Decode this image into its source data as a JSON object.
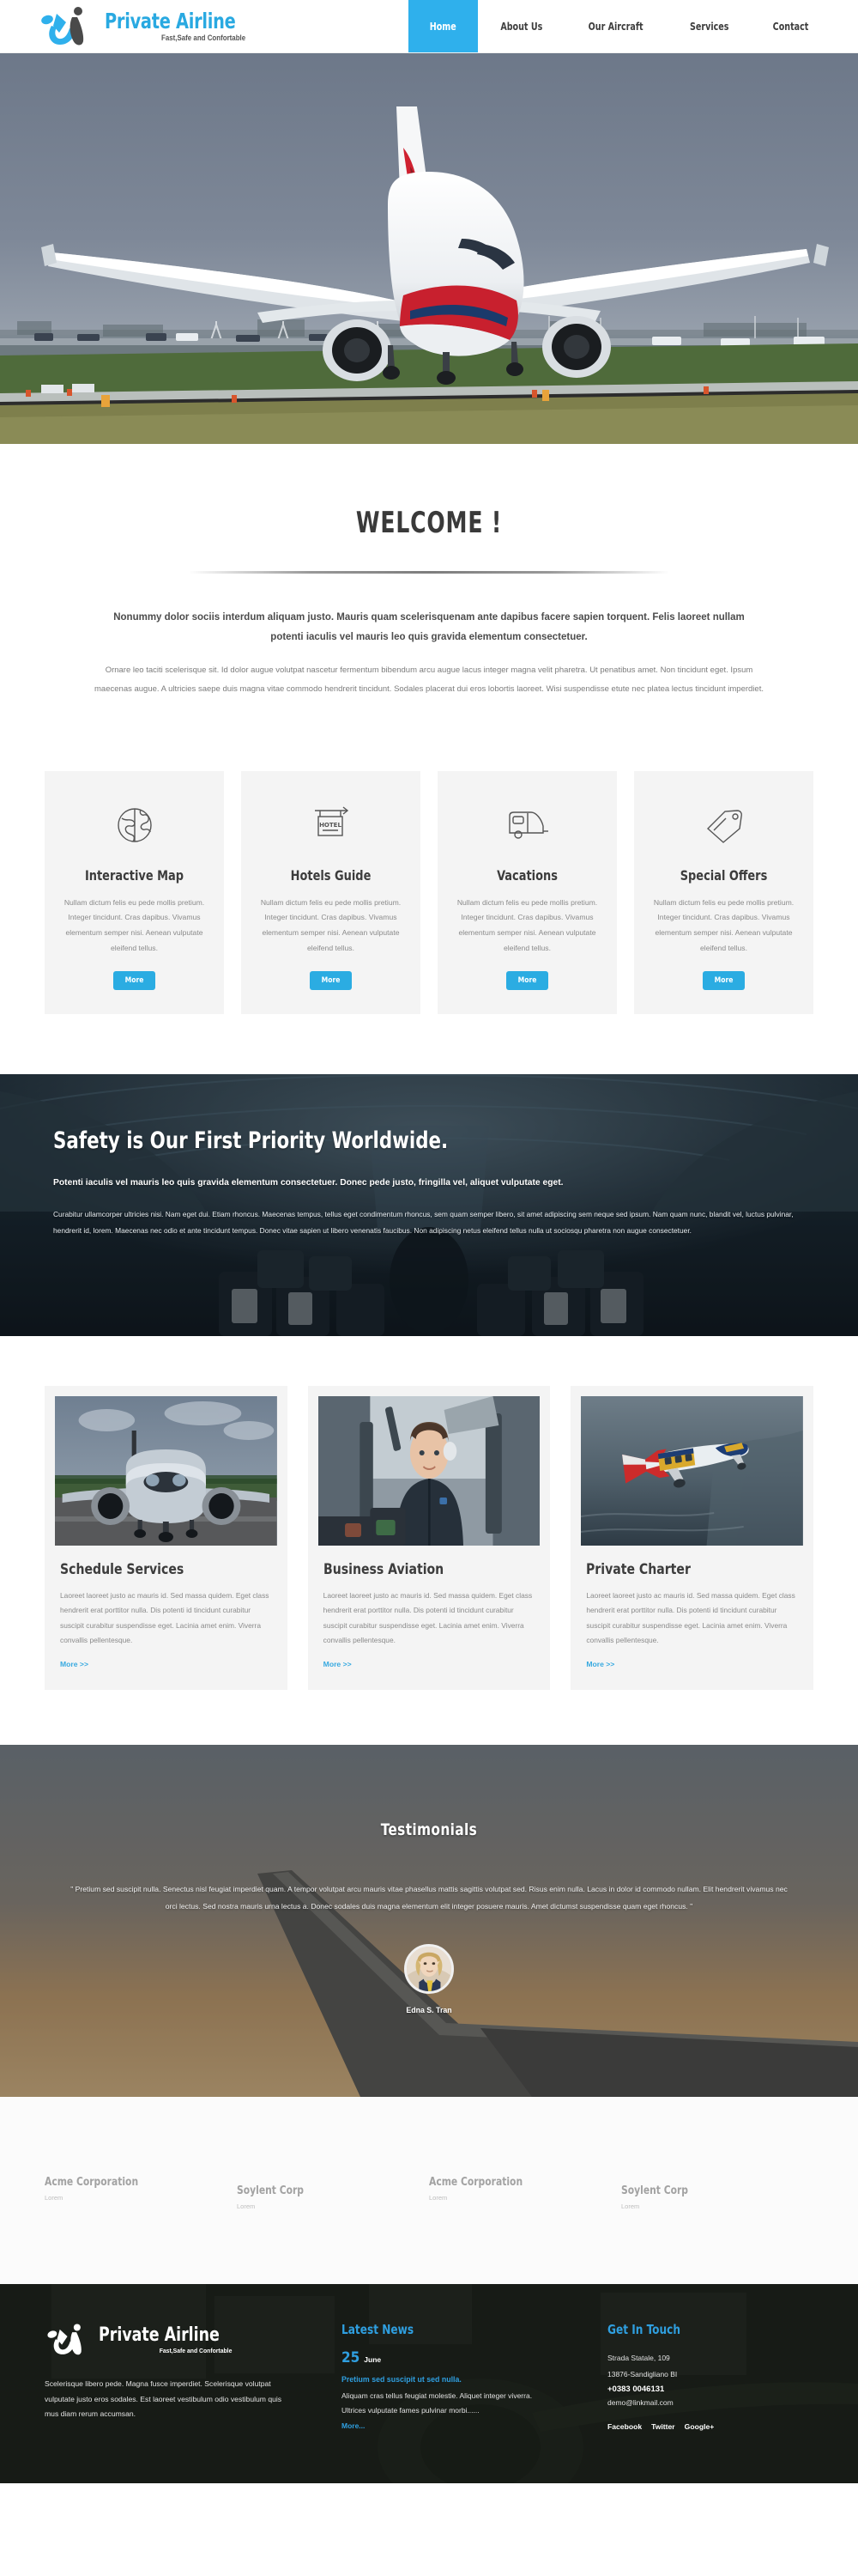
{
  "header": {
    "logo": {
      "name": "Private Airline",
      "tagline": "Fast,Safe and Confortable",
      "icon": "airline-swoosh-logo"
    },
    "nav": [
      {
        "label": "Home",
        "active": true
      },
      {
        "label": "About Us",
        "active": false
      },
      {
        "label": "Our Aircraft",
        "active": false
      },
      {
        "label": "Services",
        "active": false
      },
      {
        "label": "Contact",
        "active": false
      }
    ]
  },
  "hero": {
    "alt": "airliner-landing-photo"
  },
  "welcome": {
    "title": "WELCOME !",
    "lead": "Nonummy dolor sociis interdum aliquam justo. Mauris quam scelerisquenam ante dapibus facere sapien torquent. Felis laoreet nullam potenti iaculis vel mauris leo quis gravida elementum consectetuer.",
    "body": "Ornare leo taciti scelerisque sit. Id dolor augue volutpat nascetur fermentum bibendum arcu augue lacus integer magna velit pharetra. Ut penatibus amet. Non tincidunt eget. Ipsum maecenas augue. A ultricies saepe duis magna vitae commodo hendrerit tincidunt. Sodales placerat dui eros lobortis laoreet. Wisi suspendisse etute nec platea lectus tincidunt imperdiet."
  },
  "features": {
    "button_label": "More",
    "body_text": "Nullam dictum felis eu pede mollis pretium. Integer tincidunt. Cras dapibus. Vivamus elementum semper nisi. Aenean vulputate eleifend tellus.",
    "items": [
      {
        "title": "Interactive Map",
        "icon": "globe-icon"
      },
      {
        "title": "Hotels Guide",
        "icon": "hotel-sign-icon",
        "icon_label": "HOTEL"
      },
      {
        "title": "Vacations",
        "icon": "caravan-icon"
      },
      {
        "title": "Special Offers",
        "icon": "price-tag-icon"
      }
    ]
  },
  "safety": {
    "heading": "Safety is Our First Priority Worldwide.",
    "subheading": "Potenti iaculis vel mauris leo quis gravida elementum consectetuer. Donec pede justo, fringilla vel, aliquet vulputate eget.",
    "paragraph": "Curabitur ullamcorper ultricies nisi. Nam eget dui. Etiam rhoncus. Maecenas tempus, tellus eget condimentum rhoncus, sem quam semper libero, sit amet adipiscing sem neque sed ipsum. Nam quam nunc, blandit vel, luctus pulvinar, hendrerit id, lorem. Maecenas nec odio et ante tincidunt tempus. Donec vitae sapien ut libero venenatis faucibus. Non adipiscing netus eleifend tellus nulla ut sociosqu pharetra non augue consectetuer."
  },
  "services": {
    "more_label": "More >>",
    "body_text": "Laoreet laoreet justo ac mauris id. Sed massa quidem. Eget class hendrerit erat porttitor nulla. Dis potenti id tincidunt curabitur suscipit curabitur suspendisse eget. Lacinia amet enim. Viverra convallis pellentesque.",
    "items": [
      {
        "title": "Schedule Services",
        "image": "airliner-front-photo"
      },
      {
        "title": "Business Aviation",
        "image": "female-pilot-cockpit-photo"
      },
      {
        "title": "Private Charter",
        "image": "small-plane-over-sea-photo"
      }
    ]
  },
  "testimonials": {
    "heading": "Testimonials",
    "quote": "\" Pretium sed suscipit nulla. Senectus nisl feugiat imperdiet quam. A tempor volutpat arcu mauris vitae phasellus mattis sagittis volutpat sed. Risus enim nulla. Lacus in dolor id commodo nullam. Elit hendrerit vivamus nec orci lectus. Sed nostra mauris urna lectus a. Donec sodales duis magna elementum elit integer posuere mauris. Amet dictumst suspendisse quam eget rhoncus. \"",
    "author": "Edna S. Tran",
    "avatar": "portrait-avatar"
  },
  "clients": [
    {
      "name": "Acme Corporation",
      "sub": "Lorem"
    },
    {
      "name": "Soylent Corp",
      "sub": "Lorem"
    },
    {
      "name": "Acme Corporation",
      "sub": "Lorem"
    },
    {
      "name": "Soylent Corp",
      "sub": "Lorem"
    }
  ],
  "footer": {
    "logo": {
      "name": "Private Airline",
      "tagline": "Fast,Safe and Confortable"
    },
    "about": "Scelerisque libero pede. Magna fusce imperdiet. Scelerisque volutpat vulputate justo eros sodales. Est laoreet vestibulum odio vestibulum quis mus diam rerum accumsan.",
    "news": {
      "heading": "Latest News",
      "day": "25",
      "month": "June",
      "title": "Pretium sed suscipit ut sed nulla.",
      "body": "Aliquam cras tellus feugiat molestie.  Aliquet integer viverra. Ultrices vulputate fames pulvinar morbi......",
      "more": "More..."
    },
    "contact": {
      "heading": "Get In Touch",
      "address1": "Strada Statale, 109",
      "address2": "13876-Sandigliano BI",
      "phone": "+0383 0046131",
      "email": "demo@linkmail.com",
      "social": [
        "Facebook",
        "Twitter",
        "Google+"
      ]
    }
  },
  "colors": {
    "accent": "#2bace2",
    "nav_active": "#2fb0ec",
    "footer_bg": "#1c211c",
    "card_bg": "#f4f4f4"
  }
}
